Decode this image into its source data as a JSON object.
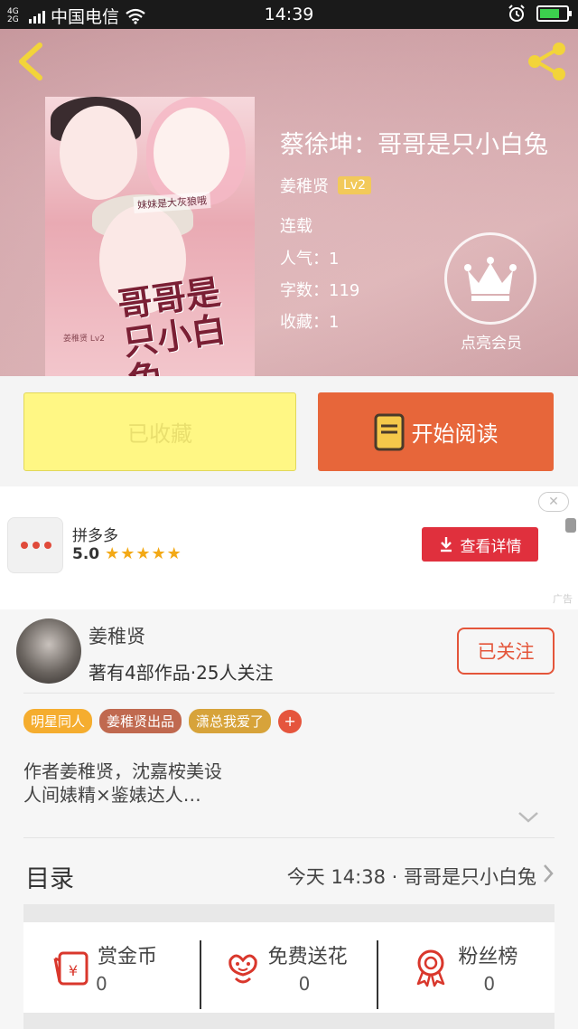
{
  "status_bar": {
    "network_type": "4G 2G",
    "carrier": "中国电信",
    "time": "14:39",
    "battery_level": 0.75
  },
  "header": {
    "back_icon": "chevron-left-icon",
    "share_icon": "share-icon"
  },
  "book": {
    "title": "蔡徐坤：哥哥是只小白兔",
    "cover": {
      "tagline": "妹妹是大灰狼哦",
      "big_title": "哥哥是只小白兔",
      "credits": "姜稚贤 Lv2"
    },
    "author": "姜稚贤",
    "author_level": "Lv2",
    "status": "连载",
    "popularity": "人气：1",
    "word_count": "字数：119",
    "favorites": "收藏：1"
  },
  "vip": {
    "icon": "crown-icon",
    "label": "点亮会员"
  },
  "actions": {
    "collected_label": "已收藏",
    "read_label": "开始阅读",
    "read_icon": "book-icon"
  },
  "ad": {
    "close_label": "✕",
    "app_name": "拼多多",
    "rating": "5.0",
    "stars": "★★★★★",
    "button_label": "查看详情",
    "tag": "广告"
  },
  "author_card": {
    "name": "姜稚贤",
    "stats": "著有4部作品·25人关注",
    "follow_label": "已关注"
  },
  "tags": [
    {
      "label": "明星同人",
      "color": "#f5ad2f"
    },
    {
      "label": "姜稚贤出品",
      "color": "#c0694f"
    },
    {
      "label": "潇总我爱了",
      "color": "#d7a33a"
    }
  ],
  "tag_add_label": "+",
  "intro": "作者姜稚贤，沈嘉桉美设\n人间婊精×鉴婊达人…",
  "toc": {
    "title": "目录",
    "latest": "今天 14:38 · 哥哥是只小白兔"
  },
  "features": [
    {
      "name": "赏金币",
      "count": "0",
      "icon": "coin-envelope-icon"
    },
    {
      "name": "免费送花",
      "count": "0",
      "icon": "flower-icon"
    },
    {
      "name": "粉丝榜",
      "count": "0",
      "icon": "ribbon-medal-icon"
    }
  ],
  "colors": {
    "accent_orange": "#e7663a",
    "collected_yellow": "#fff784",
    "ad_red": "#e0303d",
    "follow_red": "#e4553a"
  }
}
